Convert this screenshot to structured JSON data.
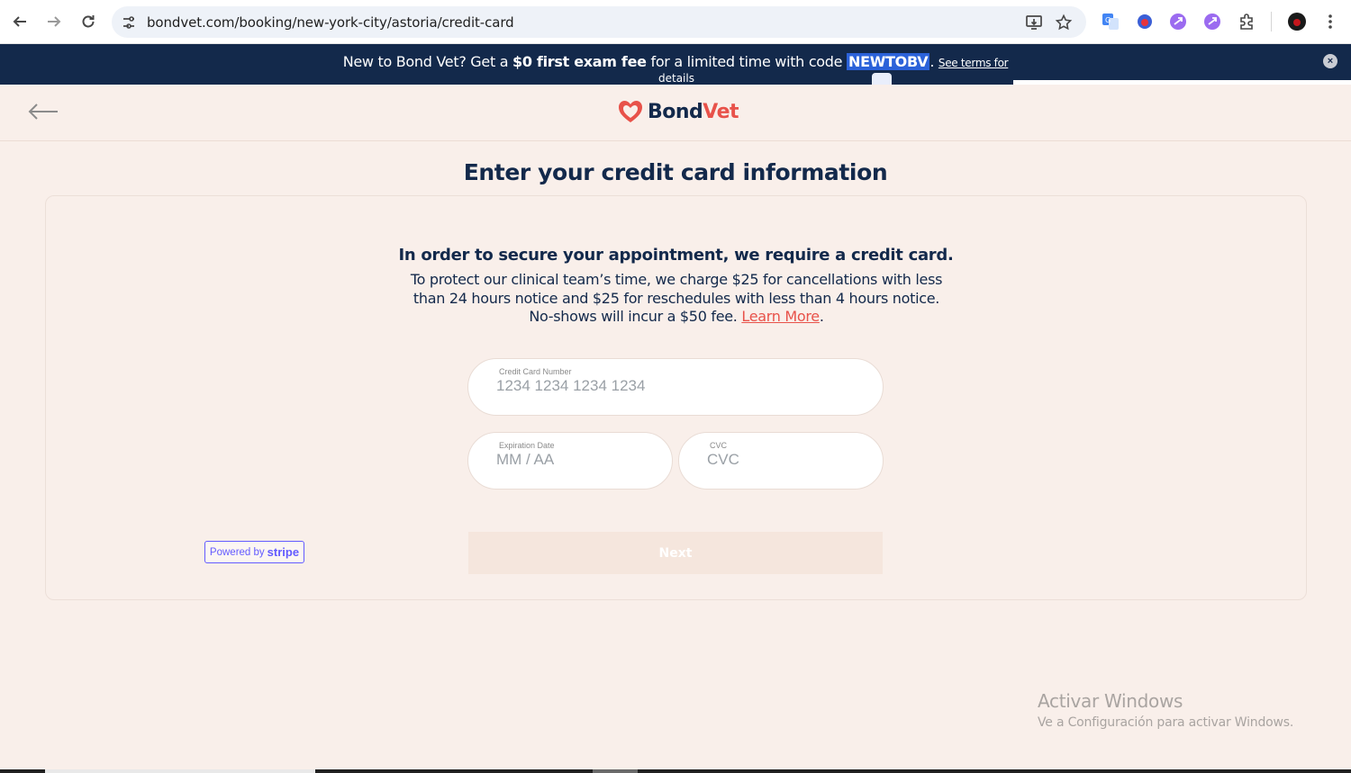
{
  "browser": {
    "url": "bondvet.com/booking/new-york-city/astoria/credit-card"
  },
  "promo": {
    "text_before": "New to Bond Vet? Get a ",
    "highlight": "$0 first exam fee",
    "text_middle": " for a limited time with code ",
    "code": "NEWTOBV",
    "text_after": ". ",
    "terms_link": "See terms for",
    "terms_link_cont": "details",
    "close_icon": "×"
  },
  "header": {
    "logo_bond": "Bond",
    "logo_vet": "Vet"
  },
  "page": {
    "title": "Enter your credit card information",
    "heading": "In order to secure your appointment, we require a credit card.",
    "body_text": "To protect our clinical team’s time, we charge $25 for cancellations with less than 24 hours notice and $25 for reschedules with less than 4 hours notice. No-shows will incur a $50 fee. ",
    "learn_more": "Learn More",
    "body_end": "."
  },
  "form": {
    "card_number_label": "Credit Card Number",
    "card_number_placeholder": "1234 1234 1234 1234",
    "expiry_label": "Expiration Date",
    "expiry_placeholder": "MM / AA",
    "cvc_label": "CVC",
    "cvc_placeholder": "CVC",
    "next_label": "Next",
    "powered_by": "Powered by",
    "stripe": "stripe"
  },
  "watermark": {
    "title": "Activar Windows",
    "subtitle": "Ve a Configuración para activar Windows."
  },
  "colors": {
    "brand_navy": "#13294b",
    "brand_red": "#e8524a",
    "background": "#f9efea",
    "stripe_purple": "#635bff"
  }
}
